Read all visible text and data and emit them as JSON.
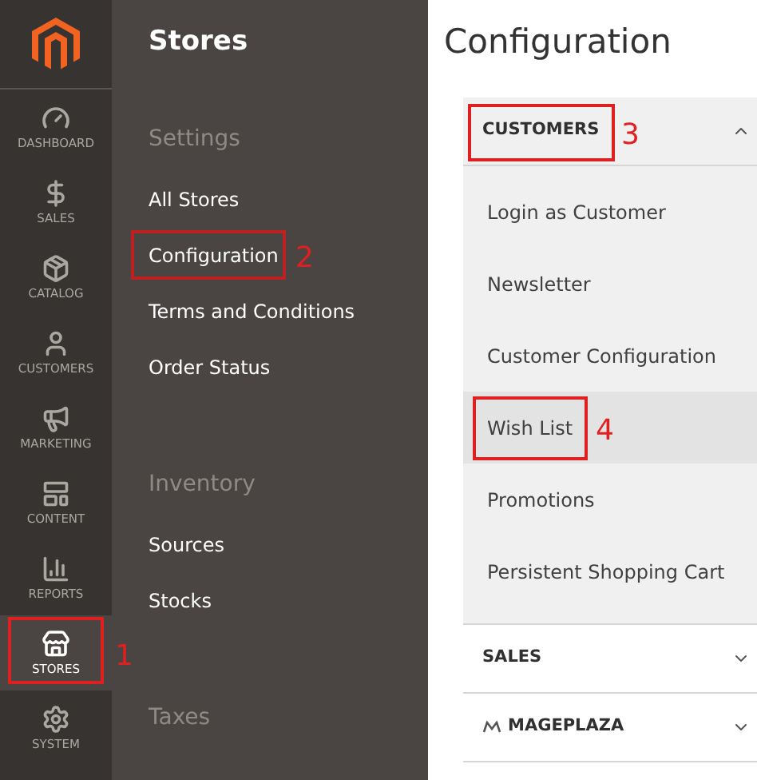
{
  "nav": [
    {
      "label": "DASHBOARD",
      "selected": false
    },
    {
      "label": "SALES",
      "selected": false
    },
    {
      "label": "CATALOG",
      "selected": false
    },
    {
      "label": "CUSTOMERS",
      "selected": false
    },
    {
      "label": "MARKETING",
      "selected": false
    },
    {
      "label": "CONTENT",
      "selected": false
    },
    {
      "label": "REPORTS",
      "selected": false
    },
    {
      "label": "STORES",
      "selected": true,
      "annotation": "1"
    },
    {
      "label": "SYSTEM",
      "selected": false
    }
  ],
  "flyout": {
    "title": "Stores",
    "groups": [
      {
        "heading": "Settings",
        "items": [
          {
            "label": "All Stores"
          },
          {
            "label": "Configuration",
            "annotation": "2"
          },
          {
            "label": "Terms and Conditions"
          },
          {
            "label": "Order Status"
          }
        ]
      },
      {
        "heading": "Inventory",
        "items": [
          {
            "label": "Sources"
          },
          {
            "label": "Stocks"
          }
        ]
      },
      {
        "heading": "Taxes"
      }
    ]
  },
  "page": {
    "title": "Configuration",
    "sections": [
      {
        "label": "CUSTOMERS",
        "kind": "plain",
        "expanded": true,
        "annotation": "3",
        "items": [
          {
            "label": "Login as Customer",
            "selected": false
          },
          {
            "label": "Newsletter",
            "selected": false
          },
          {
            "label": "Customer Configuration",
            "selected": false
          },
          {
            "label": "Wish List",
            "selected": true,
            "annotation": "4"
          },
          {
            "label": "Promotions",
            "selected": false
          },
          {
            "label": "Persistent Shopping Cart",
            "selected": false
          }
        ]
      },
      {
        "label": "SALES",
        "kind": "plain",
        "expanded": false
      },
      {
        "label": "MAGEPLAZA",
        "kind": "branded",
        "expanded": false
      }
    ]
  }
}
